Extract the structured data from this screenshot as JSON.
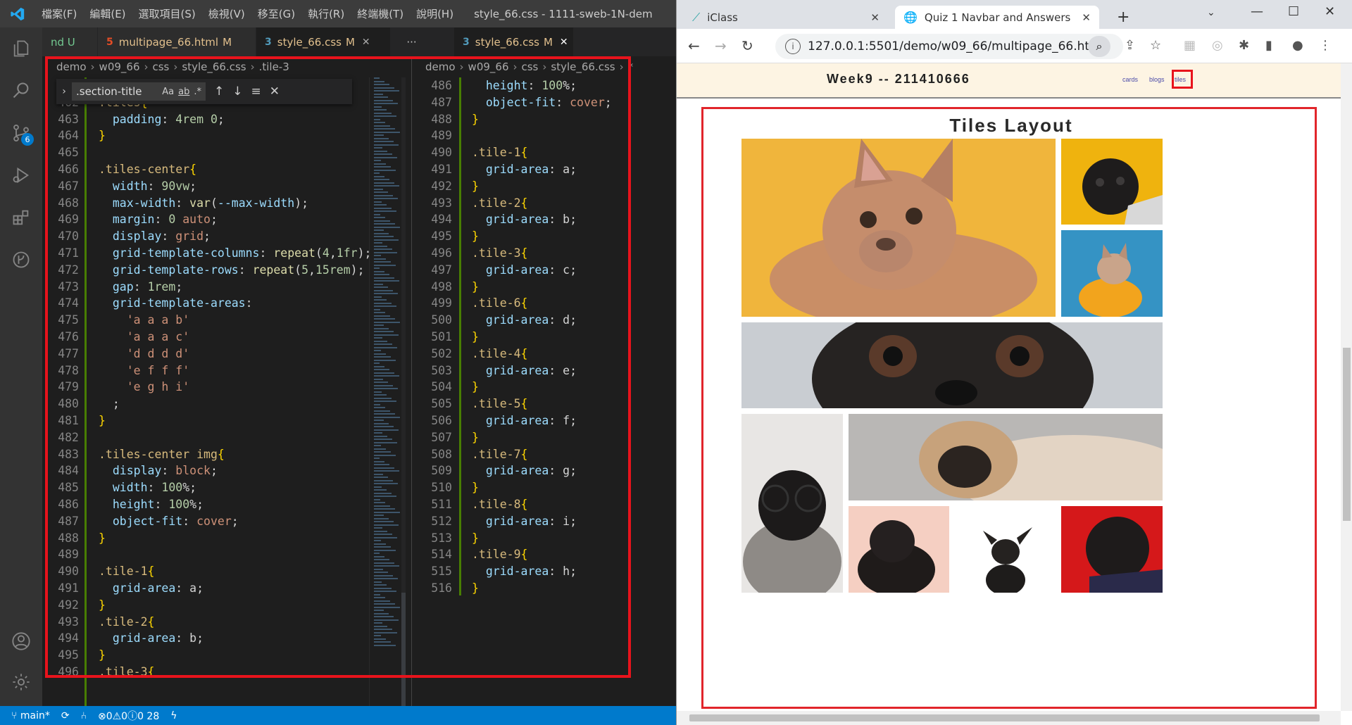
{
  "vscode": {
    "menu": [
      "檔案(F)",
      "編輯(E)",
      "選取項目(S)",
      "檢視(V)",
      "移至(G)",
      "執行(R)",
      "終端機(T)",
      "說明(H)"
    ],
    "window_title": "style_66.css - 1111-sweb-1N-dem",
    "scm_badge": "6",
    "tabs": [
      {
        "label": "nd U",
        "type": "partial"
      },
      {
        "label": "multipage_66.html",
        "mod": "M",
        "type": "html"
      },
      {
        "label": "style_66.css",
        "mod": "M",
        "type": "css"
      },
      {
        "label": "style_66.css",
        "mod": "M",
        "type": "css"
      }
    ],
    "more_label": "···",
    "breadcrumb1": [
      "demo",
      "w09_66",
      "css",
      "style_66.css",
      ".tile-3"
    ],
    "breadcrumb2": [
      "demo",
      "w09_66",
      "css",
      "style_66.css",
      "*"
    ],
    "find": {
      "query": ".section-title",
      "opt_case": "Aa",
      "opt_word": "ab",
      "opt_regex": ".*"
    },
    "status": {
      "branch": "main*",
      "problems": "⊗0⚠0ⓘ0 28"
    }
  },
  "editor1_lines": [
    {
      "n": "461",
      "t": ""
    },
    {
      "n": "462",
      "t": ".tiles{"
    },
    {
      "n": "463",
      "t": "  padding: 4rem 0;"
    },
    {
      "n": "464",
      "t": "}"
    },
    {
      "n": "465",
      "t": ""
    },
    {
      "n": "466",
      "t": ".tiles-center{"
    },
    {
      "n": "467",
      "t": "  width: 90vw;"
    },
    {
      "n": "468",
      "t": "  max-width: var(--max-width);"
    },
    {
      "n": "469",
      "t": "  margin: 0 auto;"
    },
    {
      "n": "470",
      "t": "  display: grid;"
    },
    {
      "n": "471",
      "t": "  grid-template-columns: repeat(4,1fr);"
    },
    {
      "n": "472",
      "t": "  grid-template-rows: repeat(5,15rem);"
    },
    {
      "n": "473",
      "t": "  gap: 1rem;"
    },
    {
      "n": "474",
      "t": "  grid-template-areas:"
    },
    {
      "n": "475",
      "t": "    'a a a b'"
    },
    {
      "n": "476",
      "t": "    'a a a c'"
    },
    {
      "n": "477",
      "t": "    'd d d d'"
    },
    {
      "n": "478",
      "t": "    'e f f f'"
    },
    {
      "n": "479",
      "t": "    'e g h i'"
    },
    {
      "n": "480",
      "t": "  ;"
    },
    {
      "n": "481",
      "t": "}"
    },
    {
      "n": "482",
      "t": ""
    },
    {
      "n": "483",
      "t": ".tiles-center img{"
    },
    {
      "n": "484",
      "t": "  display: block;"
    },
    {
      "n": "485",
      "t": "  width: 100%;"
    },
    {
      "n": "486",
      "t": "  height: 100%;"
    },
    {
      "n": "487",
      "t": "  object-fit: cover;"
    },
    {
      "n": "488",
      "t": "}"
    },
    {
      "n": "489",
      "t": ""
    },
    {
      "n": "490",
      "t": ".tile-1{"
    },
    {
      "n": "491",
      "t": "  grid-area: a;"
    },
    {
      "n": "492",
      "t": "}"
    },
    {
      "n": "493",
      "t": ".tile-2{"
    },
    {
      "n": "494",
      "t": "  grid-area: b;"
    },
    {
      "n": "495",
      "t": "}"
    },
    {
      "n": "496",
      "t": ".tile-3{"
    }
  ],
  "editor2_lines": [
    {
      "n": "486",
      "t": "  height: 100%;"
    },
    {
      "n": "487",
      "t": "  object-fit: cover;"
    },
    {
      "n": "488",
      "t": "}"
    },
    {
      "n": "489",
      "t": ""
    },
    {
      "n": "490",
      "t": ".tile-1{"
    },
    {
      "n": "491",
      "t": "  grid-area: a;"
    },
    {
      "n": "492",
      "t": "}"
    },
    {
      "n": "493",
      "t": ".tile-2{"
    },
    {
      "n": "494",
      "t": "  grid-area: b;"
    },
    {
      "n": "495",
      "t": "}"
    },
    {
      "n": "496",
      "t": ".tile-3{"
    },
    {
      "n": "497",
      "t": "  grid-area: c;"
    },
    {
      "n": "498",
      "t": "}"
    },
    {
      "n": "499",
      "t": ".tile-6{"
    },
    {
      "n": "500",
      "t": "  grid-area: d;"
    },
    {
      "n": "501",
      "t": "}"
    },
    {
      "n": "502",
      "t": ".tile-4{"
    },
    {
      "n": "503",
      "t": "  grid-area: e;"
    },
    {
      "n": "504",
      "t": "}"
    },
    {
      "n": "505",
      "t": ".tile-5{"
    },
    {
      "n": "506",
      "t": "  grid-area: f;"
    },
    {
      "n": "507",
      "t": "}"
    },
    {
      "n": "508",
      "t": ".tile-7{"
    },
    {
      "n": "509",
      "t": "  grid-area: g;"
    },
    {
      "n": "510",
      "t": "}"
    },
    {
      "n": "511",
      "t": ".tile-8{"
    },
    {
      "n": "512",
      "t": "  grid-area: i;"
    },
    {
      "n": "513",
      "t": "}"
    },
    {
      "n": "514",
      "t": ".tile-9{"
    },
    {
      "n": "515",
      "t": "  grid-area: h;"
    },
    {
      "n": "516",
      "t": "}"
    }
  ],
  "chrome": {
    "tabs": [
      {
        "label": "iClass"
      },
      {
        "label": "Quiz 1 Navbar and Answers"
      }
    ],
    "url": "127.0.0.1:5501/demo/w09_66/multipage_66.ht..."
  },
  "site": {
    "title": "Week9 -- 211410666",
    "nav": [
      "cards",
      "blogs",
      "tiles"
    ],
    "section_title": "Tiles Layout"
  },
  "colors": {
    "accent_red": "#e8131c",
    "vscode_blue": "#007acc",
    "header_bg": "#fdf4e3"
  }
}
